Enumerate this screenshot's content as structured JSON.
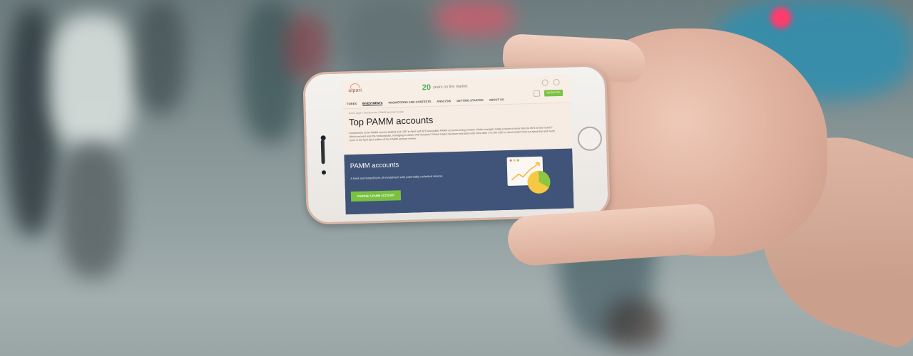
{
  "site": {
    "logo_text": "alpari",
    "anniversary_number": "20",
    "anniversary_text": "years on the market",
    "register_label": "REGISTER",
    "nav": [
      "FOREX",
      "INVESTMENTS",
      "PROMOTIONS AND CONTESTS",
      "ANALYSIS",
      "GETTING STARTED",
      "ABOUT US"
    ],
    "breadcrumb": "Home page / Investments / PAMM account review",
    "page_title": "Top PAMM accounts",
    "intro": "Investments in the PAMM service totalled 124 USD in April, with 879 new public PAMM accounts being created. Which manager made a return of more than 64.96% for the month? Which account was the most popular, managing to attract 780 investors? Which trader has been entrusted with more than 775,784 USD in client funds? Find out about this and much more in the April 2019 edition of the PAMM account review.",
    "banner": {
      "title": "PAMM accounts",
      "subtitle": "A tried and tested form of investment with potentially unlimited returns.",
      "button": "CHOOSE A PAMM ACCOUNT"
    }
  },
  "colors": {
    "accent_green": "#7ac142",
    "banner_blue": "#3f5478",
    "phone_rose_gold": "#d8b5a5",
    "bus_blue": "#2e8fb0"
  }
}
